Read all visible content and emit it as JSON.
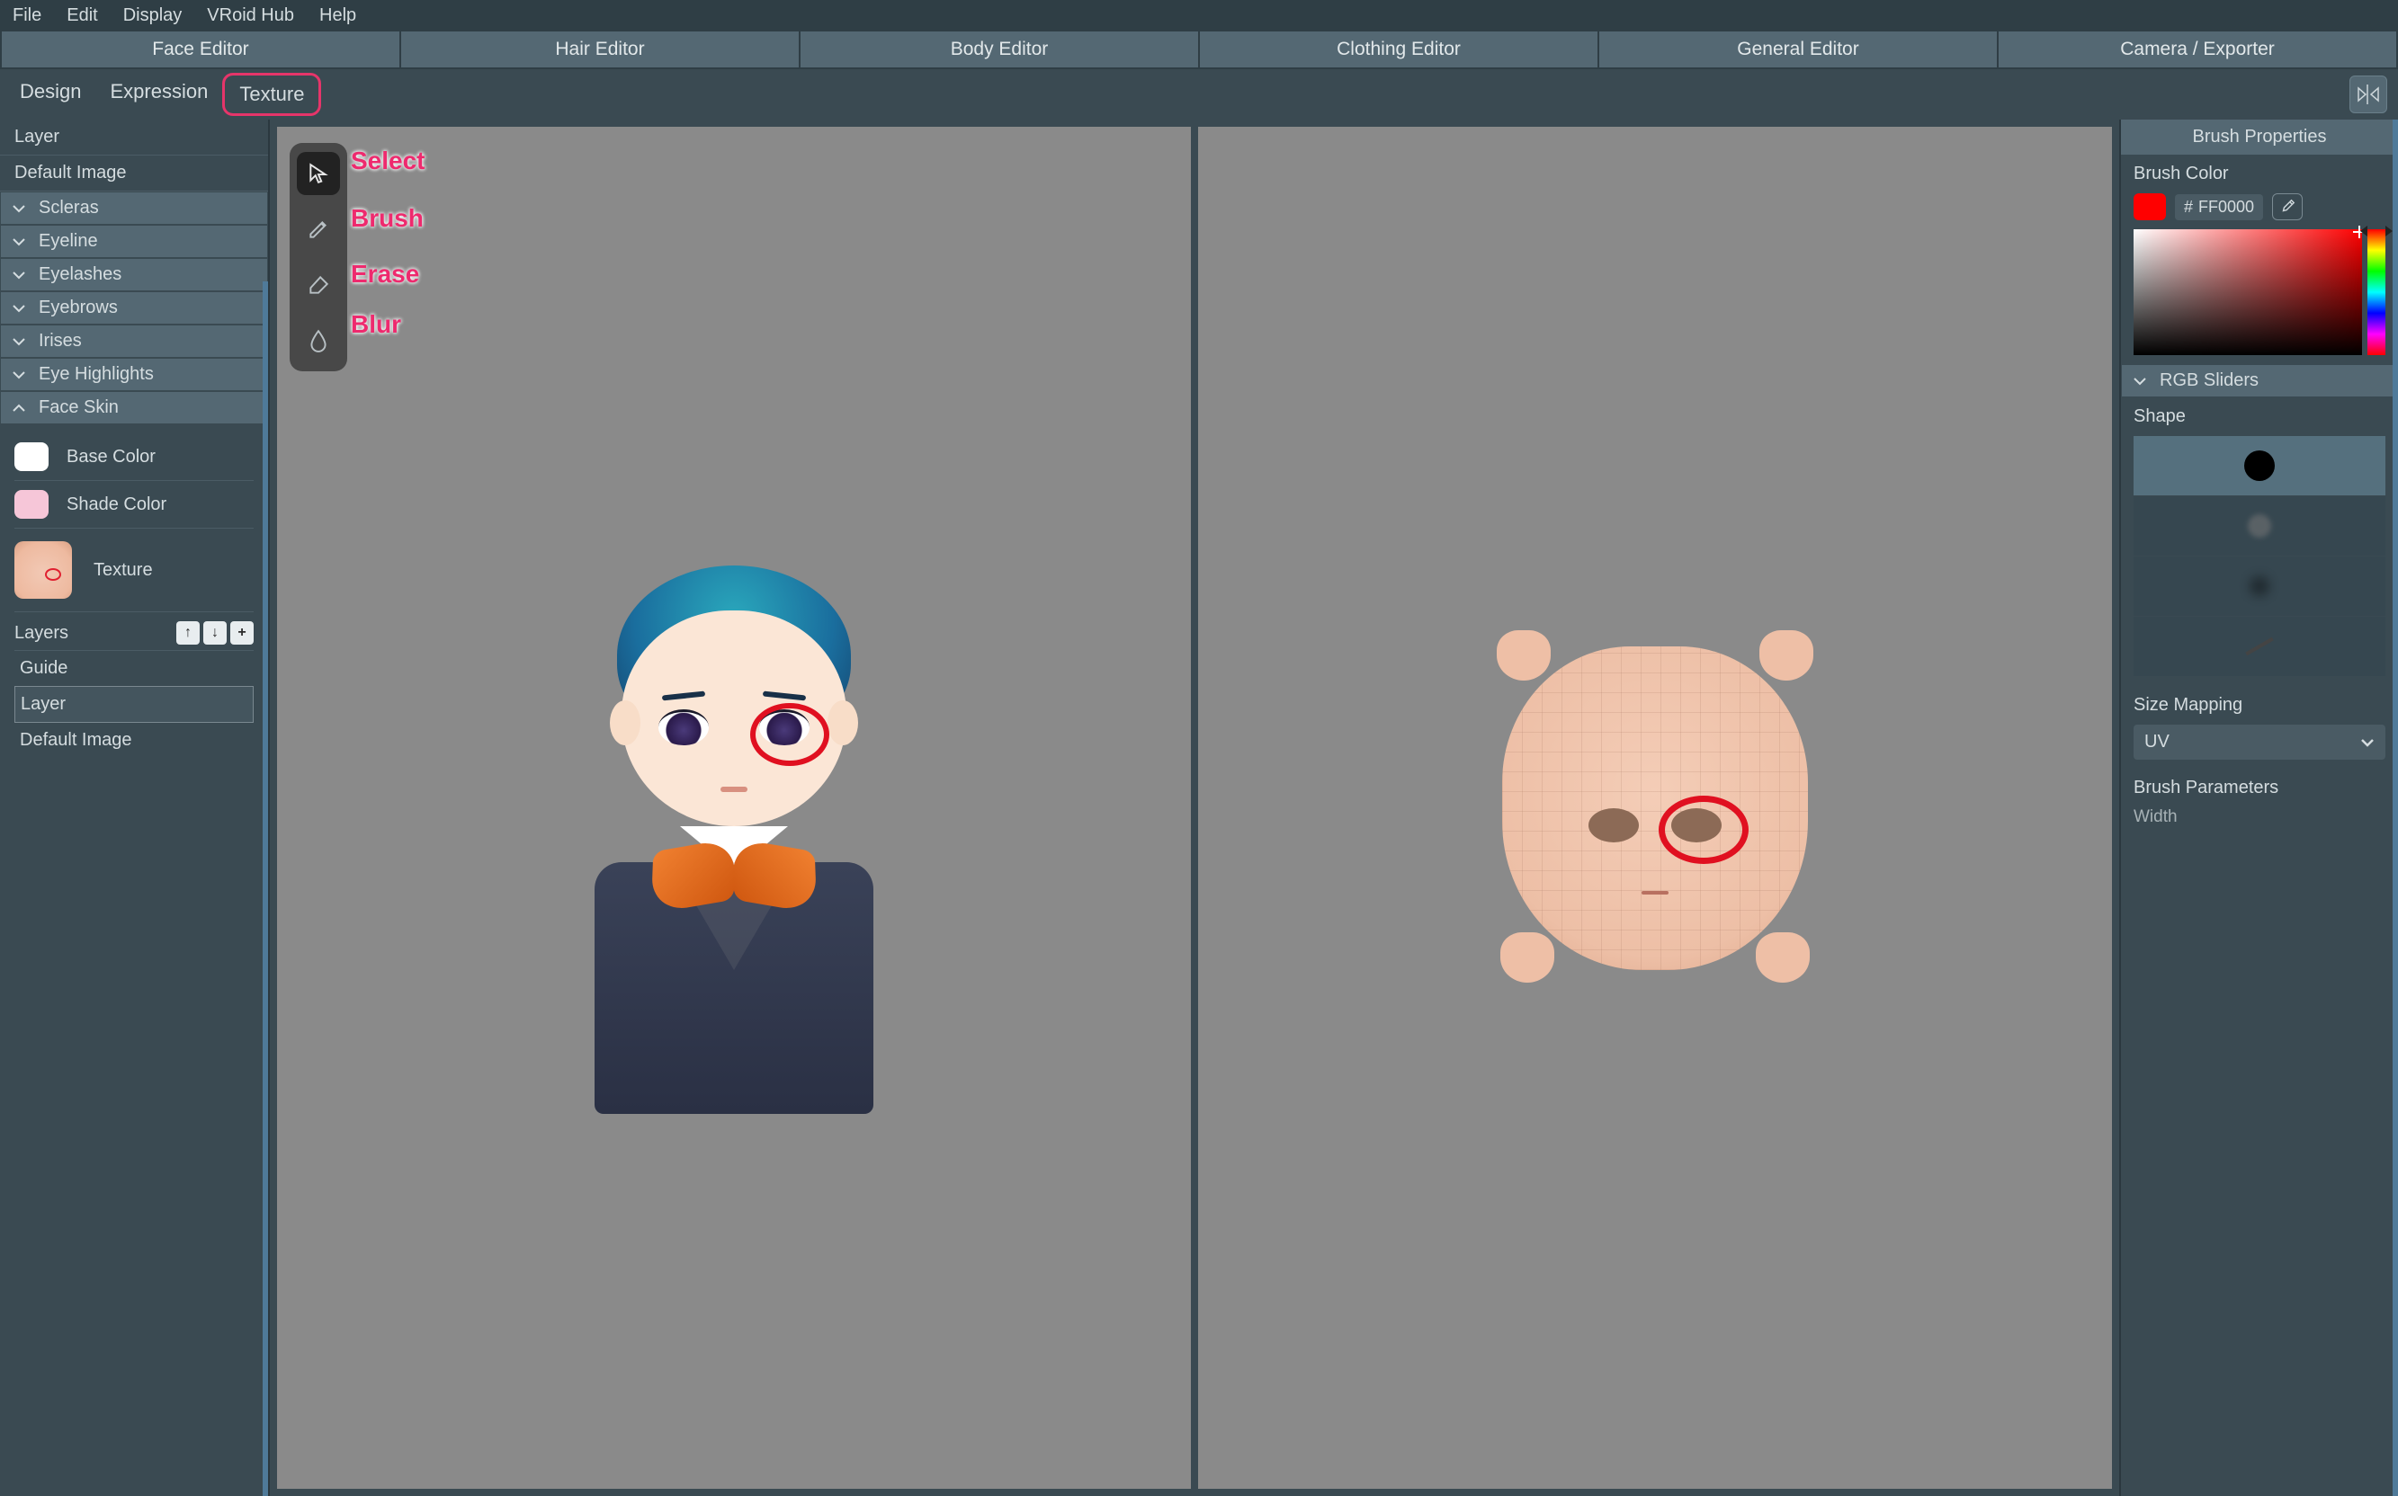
{
  "menubar": {
    "items": [
      "File",
      "Edit",
      "Display",
      "VRoid Hub",
      "Help"
    ]
  },
  "toptabs": {
    "items": [
      "Face Editor",
      "Hair Editor",
      "Body Editor",
      "Clothing Editor",
      "General Editor",
      "Camera / Exporter"
    ],
    "active_index": 0
  },
  "subtabs": {
    "items": [
      "Design",
      "Expression",
      "Texture"
    ],
    "active_index": 2
  },
  "left_panel": {
    "top_items": [
      "Layer",
      "Default Image"
    ],
    "categories": [
      {
        "label": "Scleras",
        "expanded": false
      },
      {
        "label": "Eyeline",
        "expanded": false
      },
      {
        "label": "Eyelashes",
        "expanded": false
      },
      {
        "label": "Eyebrows",
        "expanded": false
      },
      {
        "label": "Irises",
        "expanded": false
      },
      {
        "label": "Eye Highlights",
        "expanded": false
      },
      {
        "label": "Face Skin",
        "expanded": true
      }
    ],
    "face_skin": {
      "base_color_label": "Base Color",
      "shade_color_label": "Shade Color",
      "texture_label": "Texture",
      "layers_label": "Layers",
      "layers": [
        "Guide",
        "Layer",
        "Default Image"
      ],
      "selected_layer_index": 1
    }
  },
  "tool_annotations": {
    "select": "Select",
    "brush": "Brush",
    "erase": "Erase",
    "blur": "Blur"
  },
  "tools": {
    "items": [
      {
        "id": "select",
        "active": true
      },
      {
        "id": "brush",
        "active": false
      },
      {
        "id": "erase",
        "active": false
      },
      {
        "id": "blur",
        "active": false
      }
    ]
  },
  "right_panel": {
    "title": "Brush Properties",
    "brush_color_label": "Brush Color",
    "hex_prefix": "#",
    "hex_value": "FF0000",
    "rgb_sliders_label": "RGB Sliders",
    "shape_label": "Shape",
    "shape_options": [
      "hard-round",
      "soft-round-1",
      "soft-round-2",
      "line"
    ],
    "shape_selected_index": 0,
    "size_mapping_label": "Size Mapping",
    "size_mapping_value": "UV",
    "brush_parameters_label": "Brush Parameters",
    "width_label": "Width"
  }
}
